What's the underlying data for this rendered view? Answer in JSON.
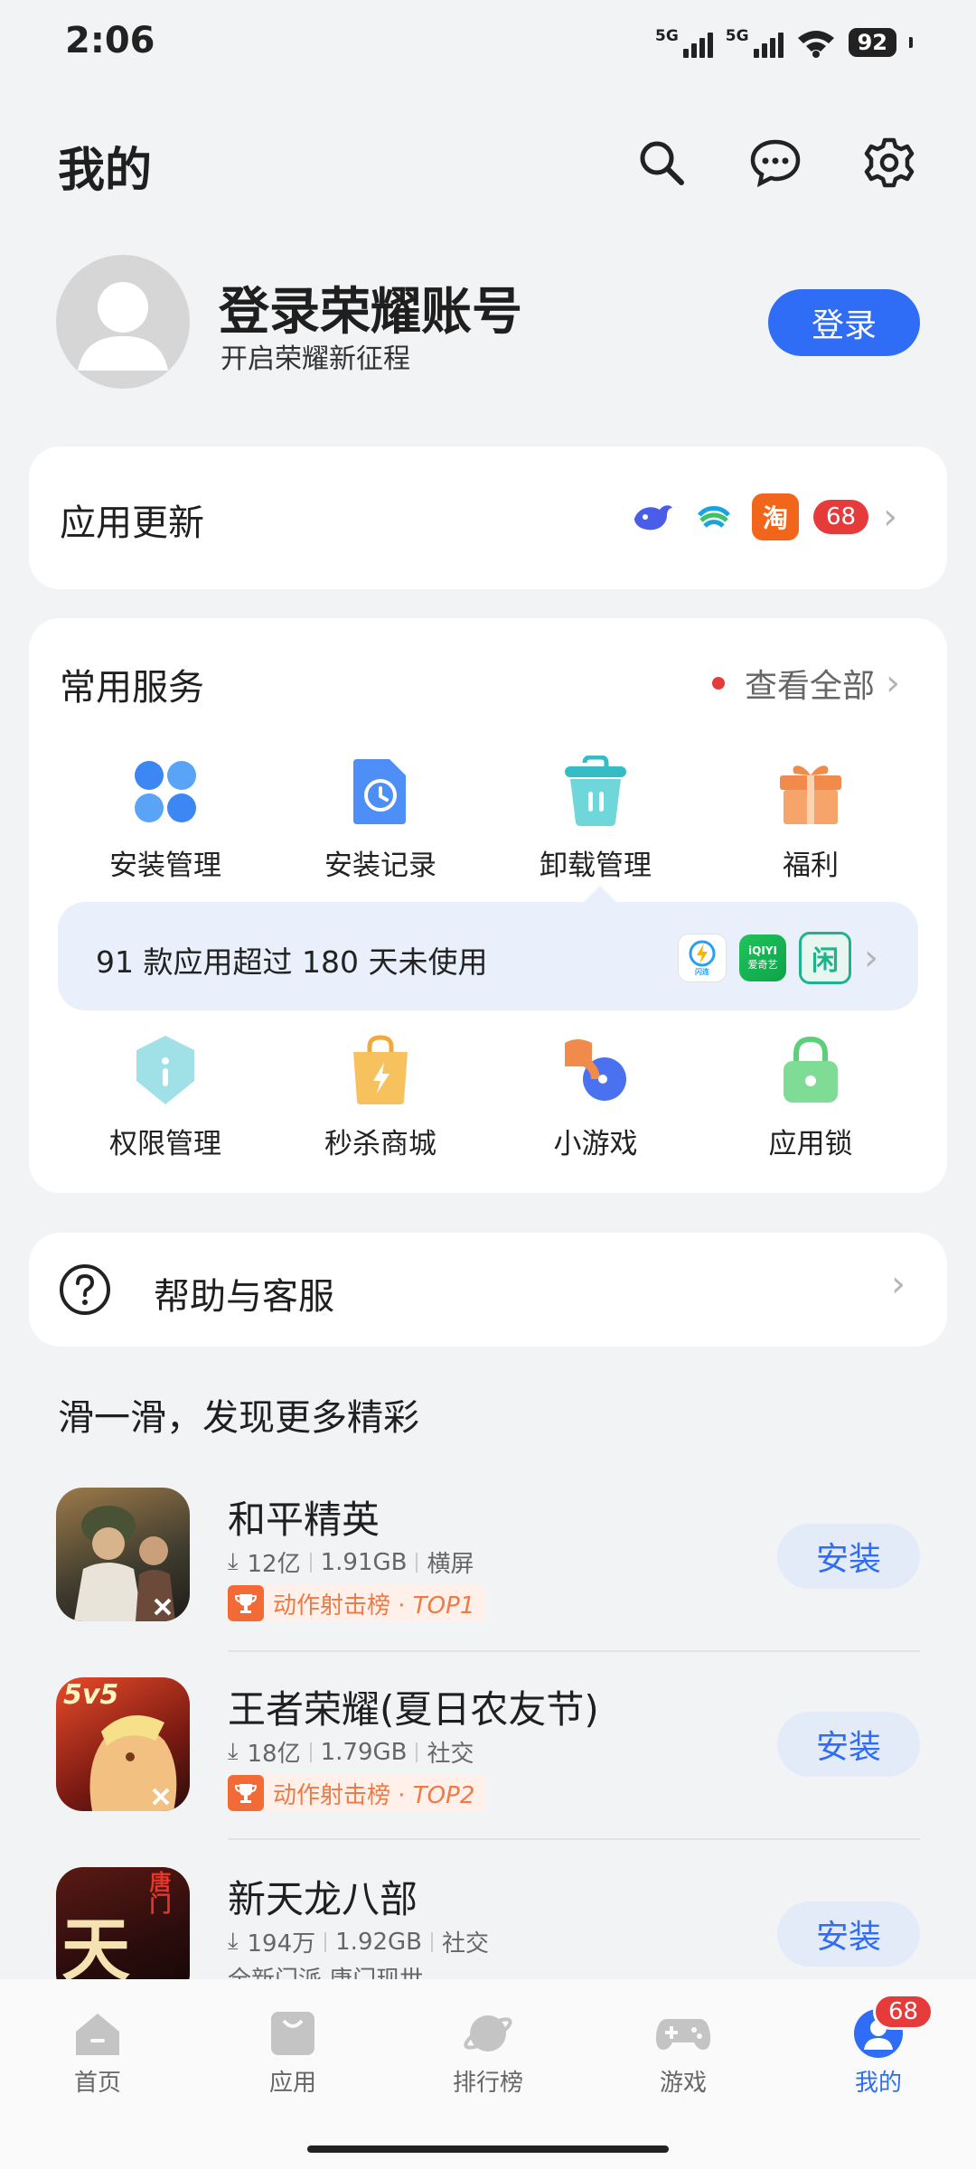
{
  "status_bar": {
    "time": "2:06",
    "net1": "5G",
    "net2": "5G",
    "battery": "92"
  },
  "header": {
    "title": "我的",
    "icons": [
      "search-icon",
      "message-icon",
      "settings-icon"
    ]
  },
  "profile": {
    "name": "登录荣耀账号",
    "subtitle": "开启荣耀新征程",
    "login_label": "登录"
  },
  "app_update": {
    "title": "应用更新",
    "count": "68",
    "mini_icons": [
      "blue-whale-app-icon",
      "china-mobile-app-icon",
      "taobao-app-icon"
    ],
    "taobao_glyph": "淘"
  },
  "services": {
    "title": "常用服务",
    "view_all": "查看全部",
    "row1": [
      {
        "label": "安装管理",
        "icon": "install-manage-icon"
      },
      {
        "label": "安装记录",
        "icon": "install-record-icon"
      },
      {
        "label": "卸载管理",
        "icon": "uninstall-manage-icon"
      },
      {
        "label": "福利",
        "icon": "gift-icon"
      }
    ],
    "tip": "91 款应用超过 180 天未使用",
    "tip_icons": [
      {
        "name": "flash-transfer-app-icon",
        "caption": "闪连"
      },
      {
        "name": "iqiyi-app-icon",
        "top": "iQIYI",
        "bottom": "爱奇艺"
      },
      {
        "name": "xianyu-app-icon",
        "glyph": "闲"
      }
    ],
    "row2": [
      {
        "label": "权限管理",
        "icon": "permission-icon"
      },
      {
        "label": "秒杀商城",
        "icon": "flash-sale-bag-icon"
      },
      {
        "label": "小游戏",
        "icon": "mini-game-icon"
      },
      {
        "label": "应用锁",
        "icon": "app-lock-icon"
      }
    ]
  },
  "help": {
    "label": "帮助与客服"
  },
  "discover": {
    "title": "滑一滑，发现更多精彩",
    "apps": [
      {
        "name": "和平精英",
        "downloads": "12亿",
        "size": "1.91GB",
        "tag": "横屏",
        "rank_text": "动作射击榜 · ",
        "rank_top": "TOP1",
        "install": "安装"
      },
      {
        "name": "王者荣耀(夏日农友节)",
        "downloads": "18亿",
        "size": "1.79GB",
        "tag": "社交",
        "rank_text": "动作射击榜 · ",
        "rank_top": "TOP2",
        "install": "安装",
        "icon_text": "5v5"
      },
      {
        "name": "新天龙八部",
        "downloads": "194万",
        "size": "1.92GB",
        "tag": "社交",
        "desc": "全新门派 唐门现世",
        "install": "安装",
        "icon_text_1": "天",
        "icon_text_2": "唐门"
      }
    ]
  },
  "bottom_nav": {
    "items": [
      {
        "label": "首页",
        "icon": "home-icon"
      },
      {
        "label": "应用",
        "icon": "apps-bag-icon"
      },
      {
        "label": "排行榜",
        "icon": "ranking-planet-icon"
      },
      {
        "label": "游戏",
        "icon": "gamepad-icon"
      },
      {
        "label": "我的",
        "icon": "profile-icon",
        "badge": "68"
      }
    ]
  },
  "colors": {
    "accent": "#2f6df6",
    "badge": "#e53b3b",
    "rank_orange": "#f26b36"
  }
}
